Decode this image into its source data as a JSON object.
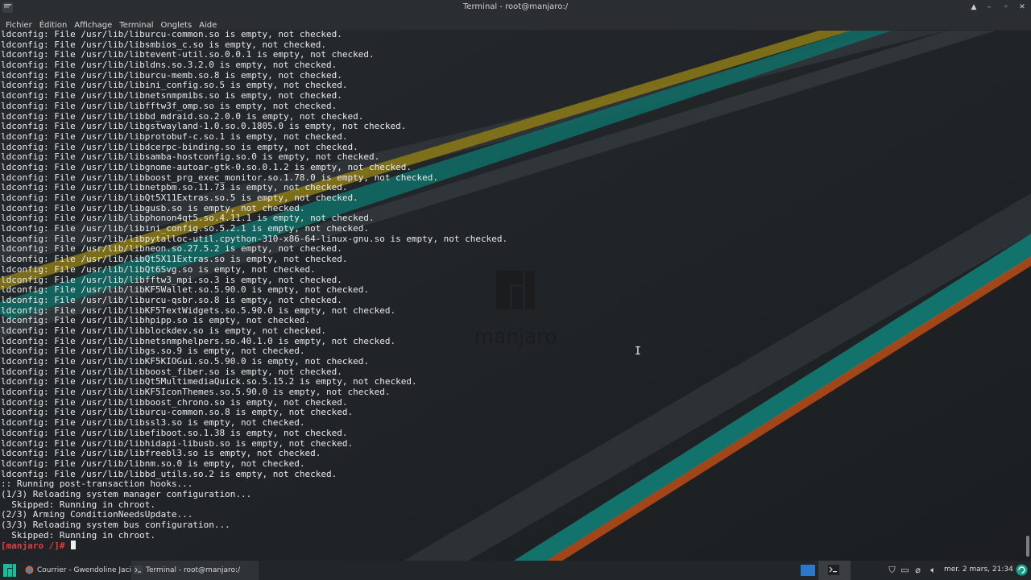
{
  "window": {
    "title": "Terminal - root@manjaro:/"
  },
  "menubar": {
    "items": [
      "Fichier",
      "Édition",
      "Affichage",
      "Terminal",
      "Onglets",
      "Aide"
    ]
  },
  "wallpaper": {
    "logo_text": "manjaro"
  },
  "terminal": {
    "lines": [
      "ldconfig: File /usr/lib/liburcu-common.so is empty, not checked.",
      "ldconfig: File /usr/lib/libsmbios_c.so is empty, not checked.",
      "ldconfig: File /usr/lib/libtevent-util.so.0.0.1 is empty, not checked.",
      "ldconfig: File /usr/lib/libldns.so.3.2.0 is empty, not checked.",
      "ldconfig: File /usr/lib/liburcu-memb.so.8 is empty, not checked.",
      "ldconfig: File /usr/lib/libini_config.so.5 is empty, not checked.",
      "ldconfig: File /usr/lib/libnetsnmpmibs.so is empty, not checked.",
      "ldconfig: File /usr/lib/libfftw3f_omp.so is empty, not checked.",
      "ldconfig: File /usr/lib/libbd_mdraid.so.2.0.0 is empty, not checked.",
      "ldconfig: File /usr/lib/libgstwayland-1.0.so.0.1805.0 is empty, not checked.",
      "ldconfig: File /usr/lib/libprotobuf-c.so.1 is empty, not checked.",
      "ldconfig: File /usr/lib/libdcerpc-binding.so is empty, not checked.",
      "ldconfig: File /usr/lib/libsamba-hostconfig.so.0 is empty, not checked.",
      "ldconfig: File /usr/lib/libgnome-autoar-gtk-0.so.0.1.2 is empty, not checked.",
      "ldconfig: File /usr/lib/libboost_prg_exec_monitor.so.1.78.0 is empty, not checked.",
      "ldconfig: File /usr/lib/libnetpbm.so.11.73 is empty, not checked.",
      "ldconfig: File /usr/lib/libQt5X11Extras.so.5 is empty, not checked.",
      "ldconfig: File /usr/lib/libgusb.so is empty, not checked.",
      "ldconfig: File /usr/lib/libphonon4qt5.so.4.11.1 is empty, not checked.",
      "ldconfig: File /usr/lib/libini_config.so.5.2.1 is empty, not checked.",
      "ldconfig: File /usr/lib/libpytalloc-util.cpython-310-x86-64-linux-gnu.so is empty, not checked.",
      "ldconfig: File /usr/lib/libneon.so.27.5.2 is empty, not checked.",
      "ldconfig: File /usr/lib/libQt5X11Extras.so is empty, not checked.",
      "ldconfig: File /usr/lib/libQt6Svg.so is empty, not checked.",
      "ldconfig: File /usr/lib/libfftw3_mpi.so.3 is empty, not checked.",
      "ldconfig: File /usr/lib/libKF5Wallet.so.5.90.0 is empty, not checked.",
      "ldconfig: File /usr/lib/liburcu-qsbr.so.8 is empty, not checked.",
      "ldconfig: File /usr/lib/libKF5TextWidgets.so.5.90.0 is empty, not checked.",
      "ldconfig: File /usr/lib/libhpipp.so is empty, not checked.",
      "ldconfig: File /usr/lib/libblockdev.so is empty, not checked.",
      "ldconfig: File /usr/lib/libnetsnmphelpers.so.40.1.0 is empty, not checked.",
      "ldconfig: File /usr/lib/libgs.so.9 is empty, not checked.",
      "ldconfig: File /usr/lib/libKF5KIOGui.so.5.90.0 is empty, not checked.",
      "ldconfig: File /usr/lib/libboost_fiber.so is empty, not checked.",
      "ldconfig: File /usr/lib/libQt5MultimediaQuick.so.5.15.2 is empty, not checked.",
      "ldconfig: File /usr/lib/libKF5IconThemes.so.5.90.0 is empty, not checked.",
      "ldconfig: File /usr/lib/libboost_chrono.so is empty, not checked.",
      "ldconfig: File /usr/lib/liburcu-common.so.8 is empty, not checked.",
      "ldconfig: File /usr/lib/libssl3.so is empty, not checked.",
      "ldconfig: File /usr/lib/libefiboot.so.1.38 is empty, not checked.",
      "ldconfig: File /usr/lib/libhidapi-libusb.so is empty, not checked.",
      "ldconfig: File /usr/lib/libfreebl3.so is empty, not checked.",
      "ldconfig: File /usr/lib/libnm.so.0 is empty, not checked.",
      "ldconfig: File /usr/lib/libbd_utils.so.2 is empty, not checked.",
      ":: Running post-transaction hooks...",
      "(1/3) Reloading system manager configuration...",
      "  Skipped: Running in chroot.",
      "(2/3) Arming ConditionNeedsUpdate...",
      "(3/3) Reloading system bus configuration...",
      "  Skipped: Running in chroot."
    ],
    "prompt": "[manjaro /]# "
  },
  "taskbar": {
    "tasks": [
      {
        "label": "Courrier - Gwendoline Jaci..."
      },
      {
        "label": "Terminal - root@manjaro:/"
      }
    ],
    "clock": "mer. 2 mars, 21:34"
  },
  "colors": {
    "accent_green": "#16a085",
    "prompt_red": "#e0403a",
    "stripe_yellow": "#b8a018",
    "stripe_teal": "#168a80",
    "stripe_orange": "#c8541c"
  }
}
